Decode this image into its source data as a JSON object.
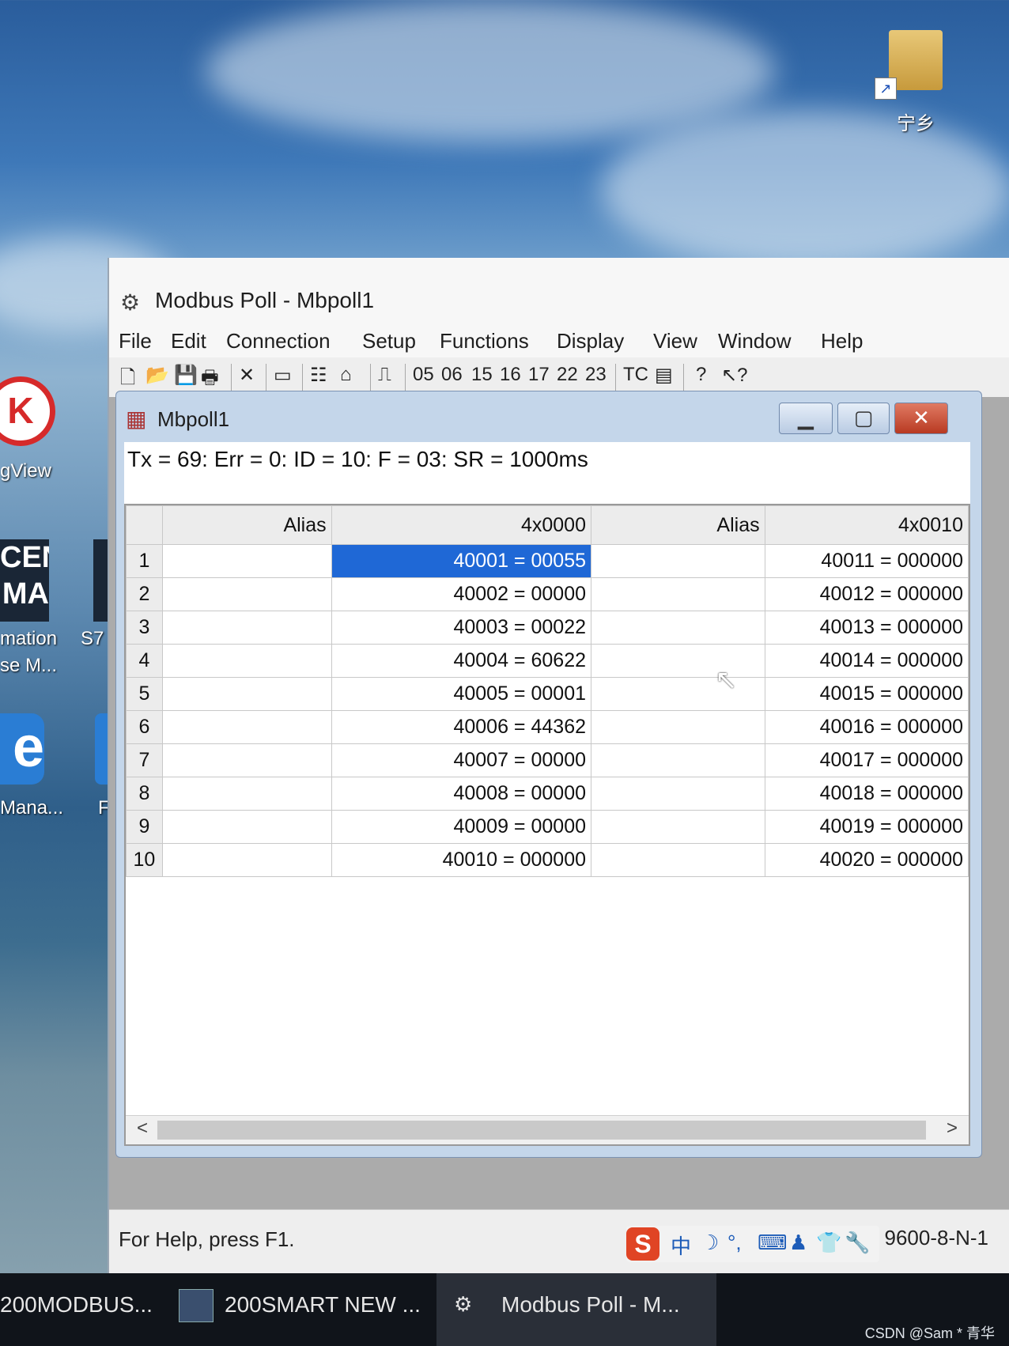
{
  "desktop": {
    "folder_label": "宁乡",
    "folder_shortcut_glyph": "↗",
    "icons": [
      {
        "label": "gView"
      },
      {
        "label": "mation"
      },
      {
        "label": "se M..."
      },
      {
        "label": "S7"
      },
      {
        "label": "Mana..."
      },
      {
        "label": "F"
      }
    ],
    "k_logo_text": "K",
    "cema_text": "CEN\nMA",
    "e_logo_text": "e"
  },
  "app": {
    "title": "Modbus Poll - Mbpoll1",
    "menu": [
      "File",
      "Edit",
      "Connection",
      "Setup",
      "Functions",
      "Display",
      "View",
      "Window",
      "Help"
    ],
    "toolbar_codes": [
      "05",
      "06",
      "15",
      "16",
      "17",
      "22",
      "23"
    ],
    "toolbar_tc": "TC",
    "statusbar_help": "For Help, press F1.",
    "statusbar_port": "Port 4: 9600-8-N-1"
  },
  "child": {
    "title": "Mbpoll1",
    "status_line": "Tx = 69: Err = 0: ID = 10: F = 03: SR = 1000ms",
    "columns": [
      {
        "alias_header": "Alias",
        "value_header": "4x0000"
      },
      {
        "alias_header": "Alias",
        "value_header": "4x0010"
      }
    ],
    "rows": [
      {
        "num": "1",
        "c1": "40001 = 00055",
        "c2": "40011 = 000000"
      },
      {
        "num": "2",
        "c1": "40002 = 00000",
        "c2": "40012 = 000000"
      },
      {
        "num": "3",
        "c1": "40003 = 00022",
        "c2": "40013 = 000000"
      },
      {
        "num": "4",
        "c1": "40004 = 60622",
        "c2": "40014 = 000000"
      },
      {
        "num": "5",
        "c1": "40005 = 00001",
        "c2": "40015 = 000000"
      },
      {
        "num": "6",
        "c1": "40006 = 44362",
        "c2": "40016 = 000000"
      },
      {
        "num": "7",
        "c1": "40007 = 00000",
        "c2": "40017 = 000000"
      },
      {
        "num": "8",
        "c1": "40008 = 00000",
        "c2": "40018 = 000000"
      },
      {
        "num": "9",
        "c1": "40009 = 00000",
        "c2": "40019 = 000000"
      },
      {
        "num": "10",
        "c1": "40010 = 000000",
        "c2": "40020 = 000000"
      }
    ],
    "scroll_left": "<",
    "scroll_right": ">"
  },
  "ime": {
    "logo": "S",
    "items": [
      "中",
      "☽",
      "°,",
      "⌨",
      "♟",
      "👕",
      "🔧"
    ]
  },
  "taskbar": {
    "items": [
      "200MODBUS...",
      "200SMART NEW ...",
      "Modbus Poll - M..."
    ]
  },
  "watermark": "CSDN @Sam * 青华",
  "colors": {
    "selection": "#1f68d6",
    "close_button": "#c24a32",
    "titlebar": "#f7f7f7"
  }
}
